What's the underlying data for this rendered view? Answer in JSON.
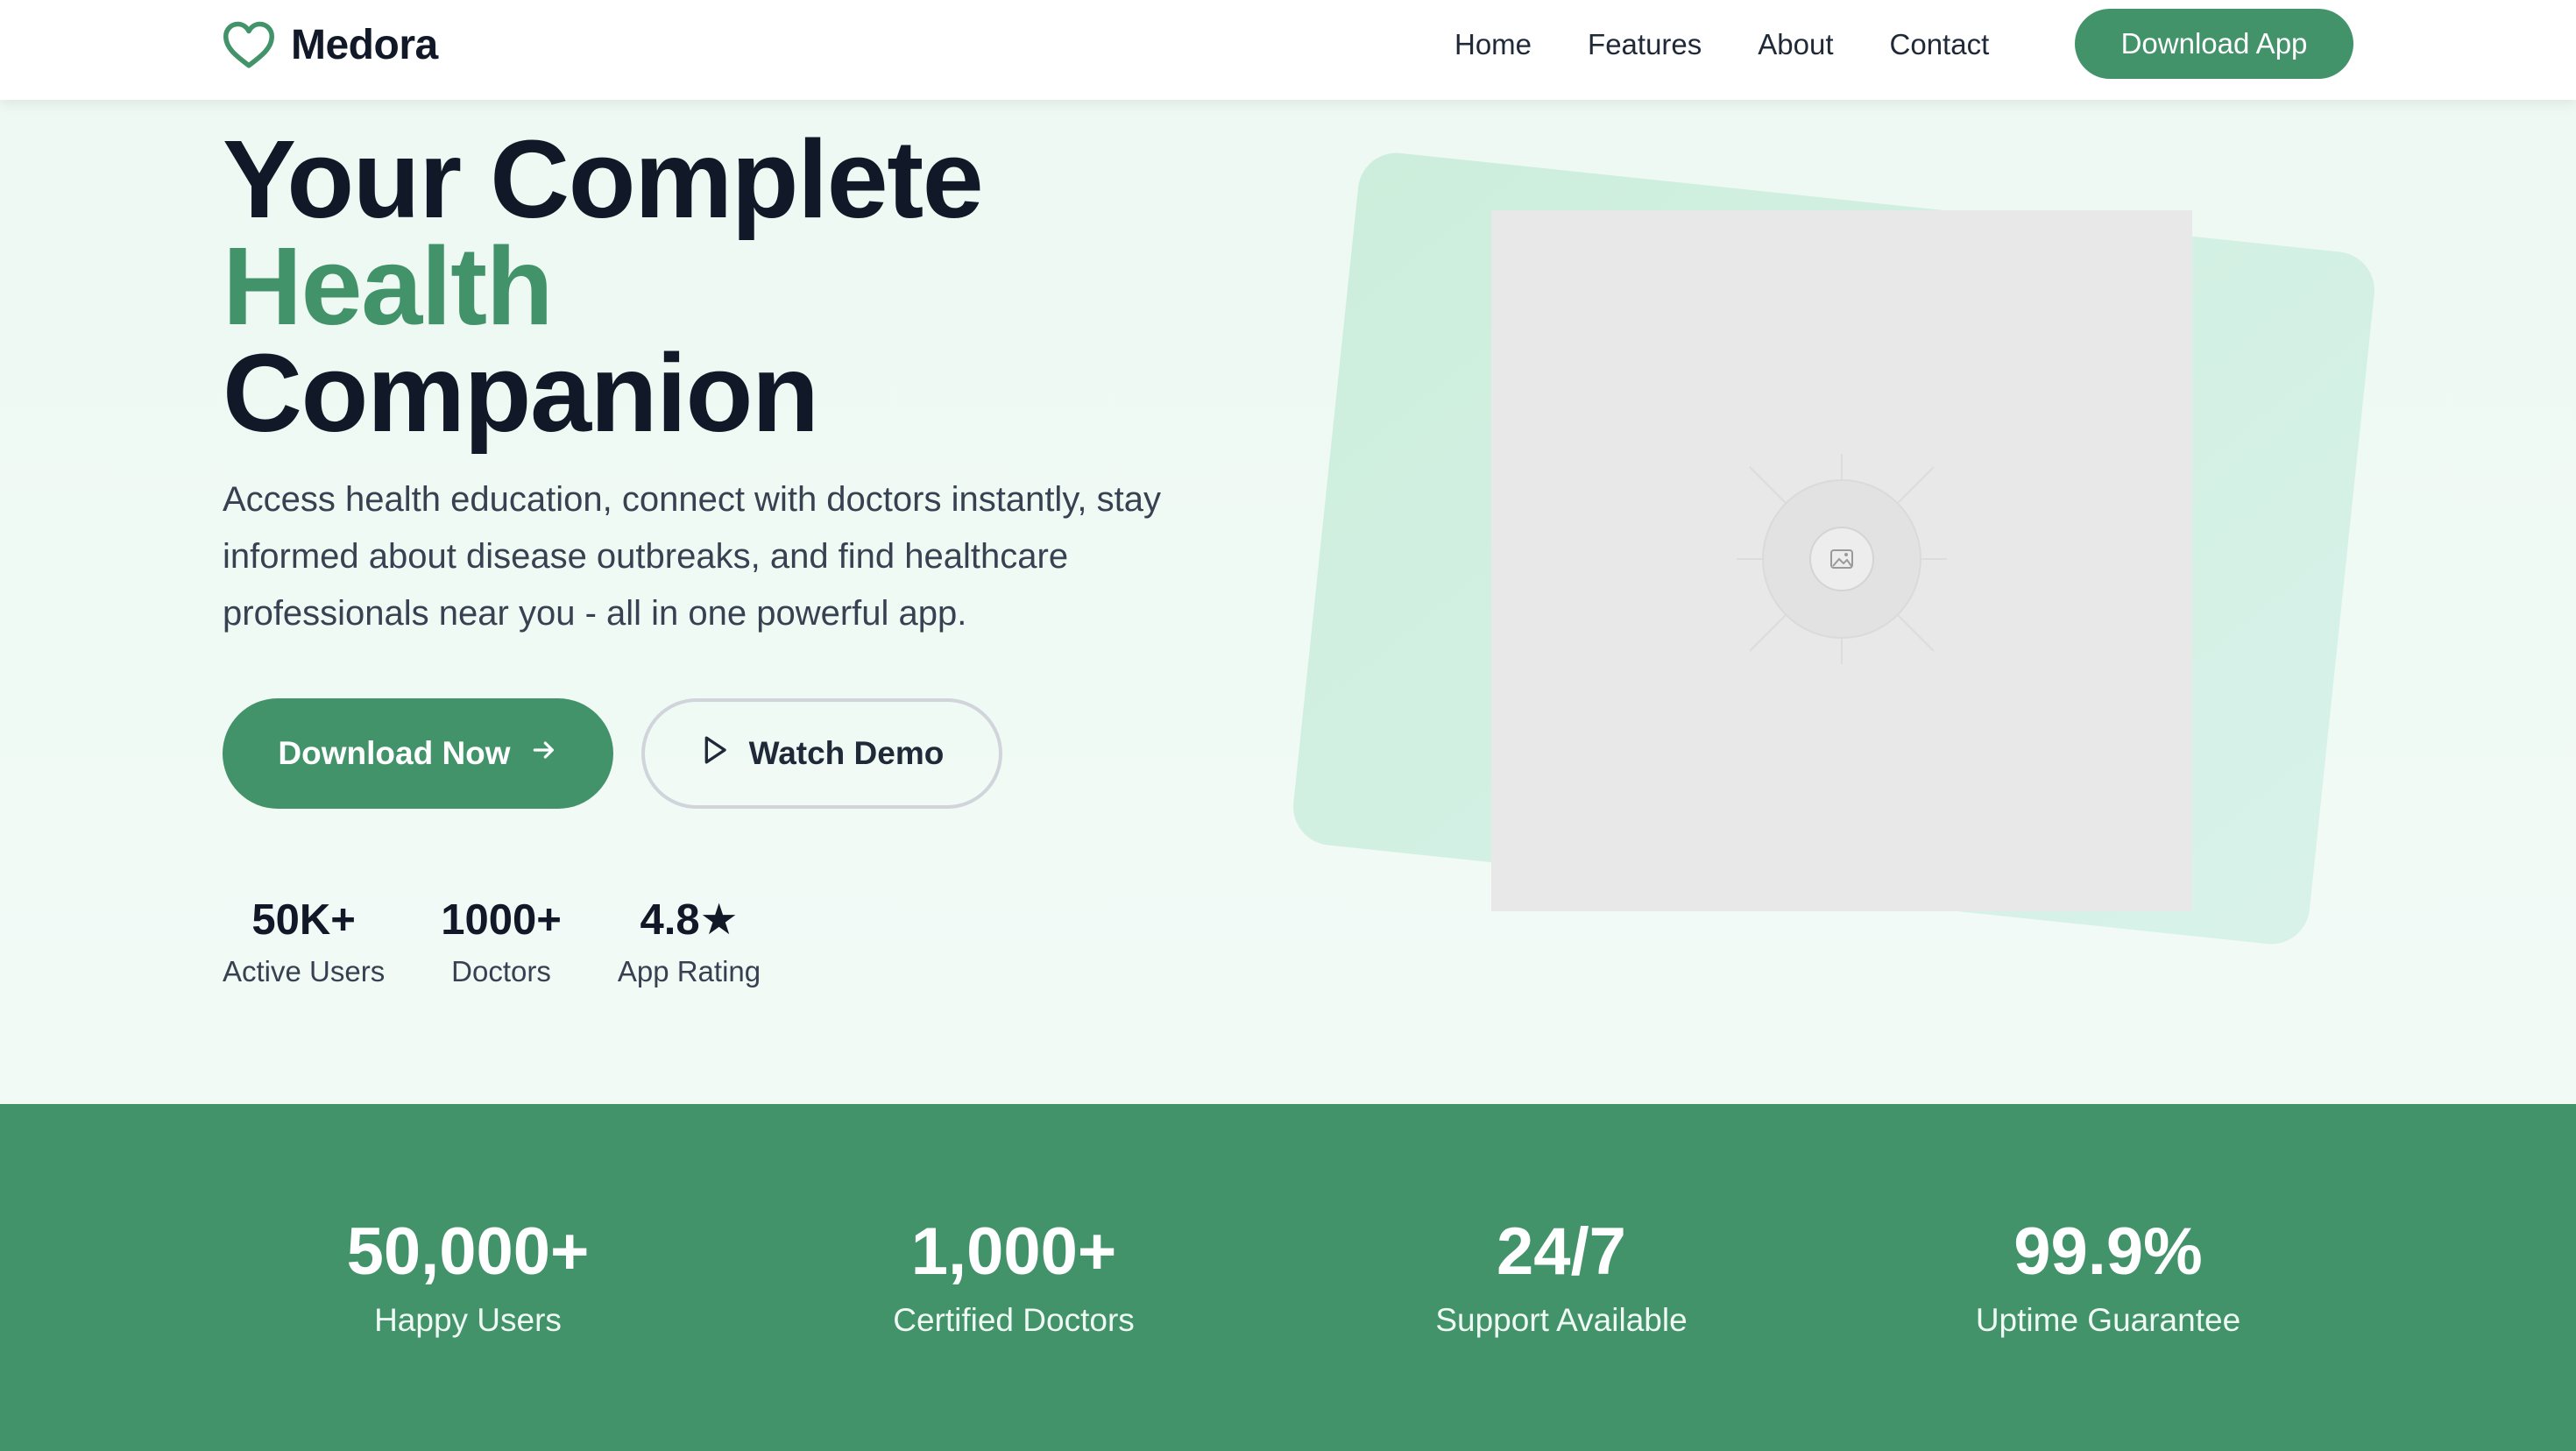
{
  "brand": {
    "name": "Medora",
    "icon": "heart-icon",
    "accent_color": "#43936a"
  },
  "nav": {
    "items": [
      {
        "label": "Home"
      },
      {
        "label": "Features"
      },
      {
        "label": "About"
      },
      {
        "label": "Contact"
      }
    ],
    "cta_label": "Download App"
  },
  "hero": {
    "title_line1": "Your Complete",
    "title_accent": "Health",
    "title_line3": "Companion",
    "subtitle": "Access health education, connect with doctors instantly, stay informed about disease outbreaks, and find healthcare professionals near you - all in one powerful app.",
    "primary_button": {
      "label": "Download Now",
      "icon": "arrow-right-icon"
    },
    "secondary_button": {
      "label": "Watch Demo",
      "icon": "play-icon"
    },
    "mini_stats": [
      {
        "value": "50K+",
        "label": "Active Users"
      },
      {
        "value": "1000+",
        "label": "Doctors"
      },
      {
        "value": "4.8★",
        "label": "App Rating"
      }
    ],
    "image": {
      "icon": "image-placeholder-icon"
    }
  },
  "stats_band": {
    "items": [
      {
        "value": "50,000+",
        "label": "Happy Users"
      },
      {
        "value": "1,000+",
        "label": "Certified Doctors"
      },
      {
        "value": "24/7",
        "label": "Support Available"
      },
      {
        "value": "99.9%",
        "label": "Uptime Guarantee"
      }
    ]
  }
}
